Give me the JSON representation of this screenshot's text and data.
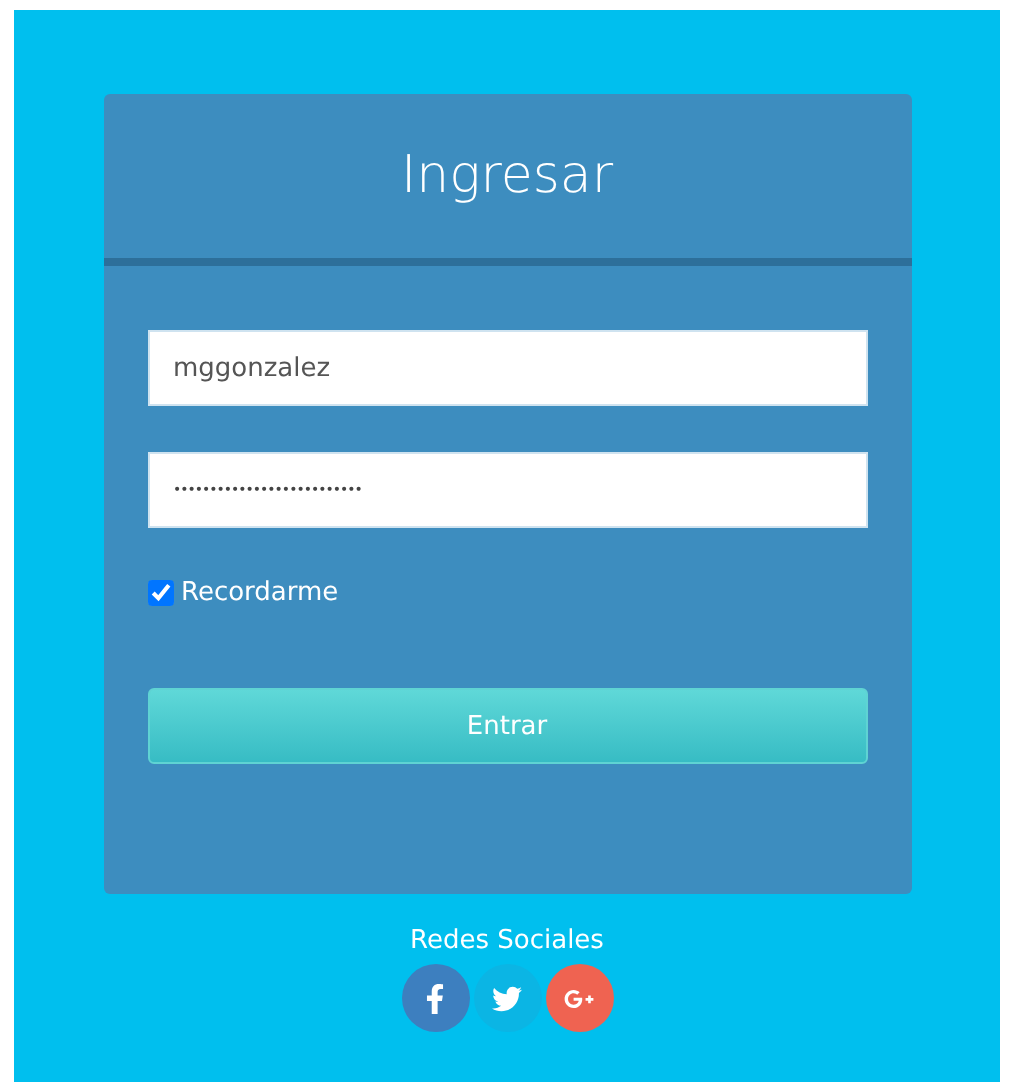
{
  "login": {
    "title": "Ingresar",
    "username": {
      "value": "mggonzalez"
    },
    "password": {
      "value": "••••••••••••••••••••••••••"
    },
    "remember": {
      "label": "Recordarme",
      "checked": true
    },
    "submit": {
      "label": "Entrar"
    }
  },
  "social": {
    "title": "Redes Sociales",
    "links": [
      {
        "kind": "facebook",
        "color": "#3d7fbf"
      },
      {
        "kind": "twitter",
        "color": "#0bb5e4"
      },
      {
        "kind": "google",
        "color": "#ef6351"
      }
    ]
  }
}
